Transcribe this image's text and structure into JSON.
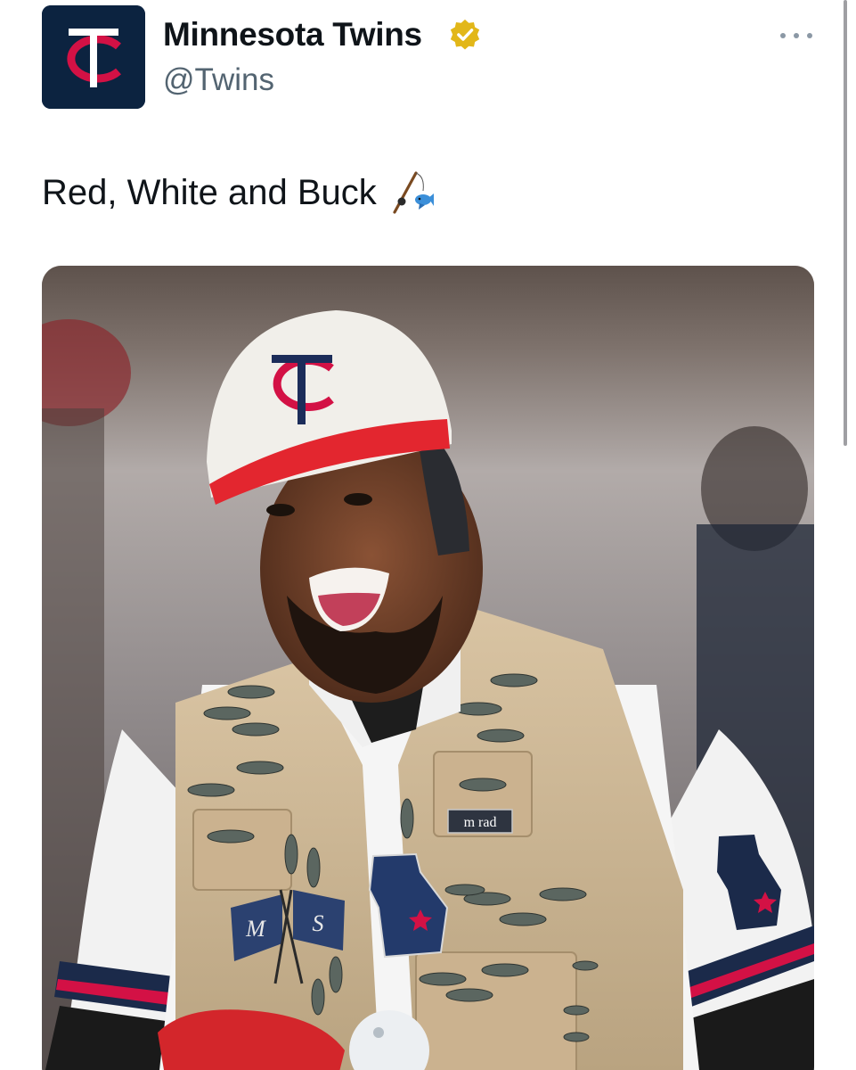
{
  "author": {
    "name": "Minnesota Twins",
    "handle": "@Twins",
    "verified": true,
    "avatar_icon": "twins-tc-logo-icon",
    "colors": {
      "navy": "#0c2340",
      "red": "#d31145",
      "verified_gold": "#e2b719"
    }
  },
  "tweet": {
    "text": "Red, White and Buck",
    "emoji_icon": "fishing-pole-emoji-icon"
  },
  "media": {
    "type": "photo",
    "vest_patch_text": "m rad"
  },
  "actions": {
    "more_icon": "more-options-icon"
  }
}
